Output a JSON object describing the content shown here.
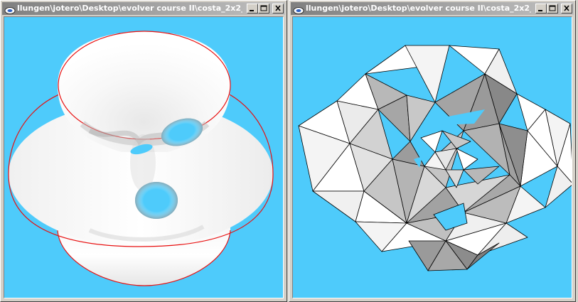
{
  "left_window": {
    "title": "llungen\\jotero\\Desktop\\evolver course II\\costa_2x2_...",
    "icon": "evolver-app-icon",
    "content": "costa-minimal-surface-smooth-render"
  },
  "right_window": {
    "title": "llungen\\jotero\\Desktop\\evolver course II\\costa_2x2_...",
    "icon": "evolver-app-icon",
    "content": "costa-minimal-surface-triangulated-render"
  },
  "caption_buttons": [
    "minimize",
    "maximize",
    "close"
  ],
  "colors": {
    "viewport_background": "#4ecbfb",
    "boundary_curve": "#e81010",
    "titlebar_inactive": "#808080"
  }
}
